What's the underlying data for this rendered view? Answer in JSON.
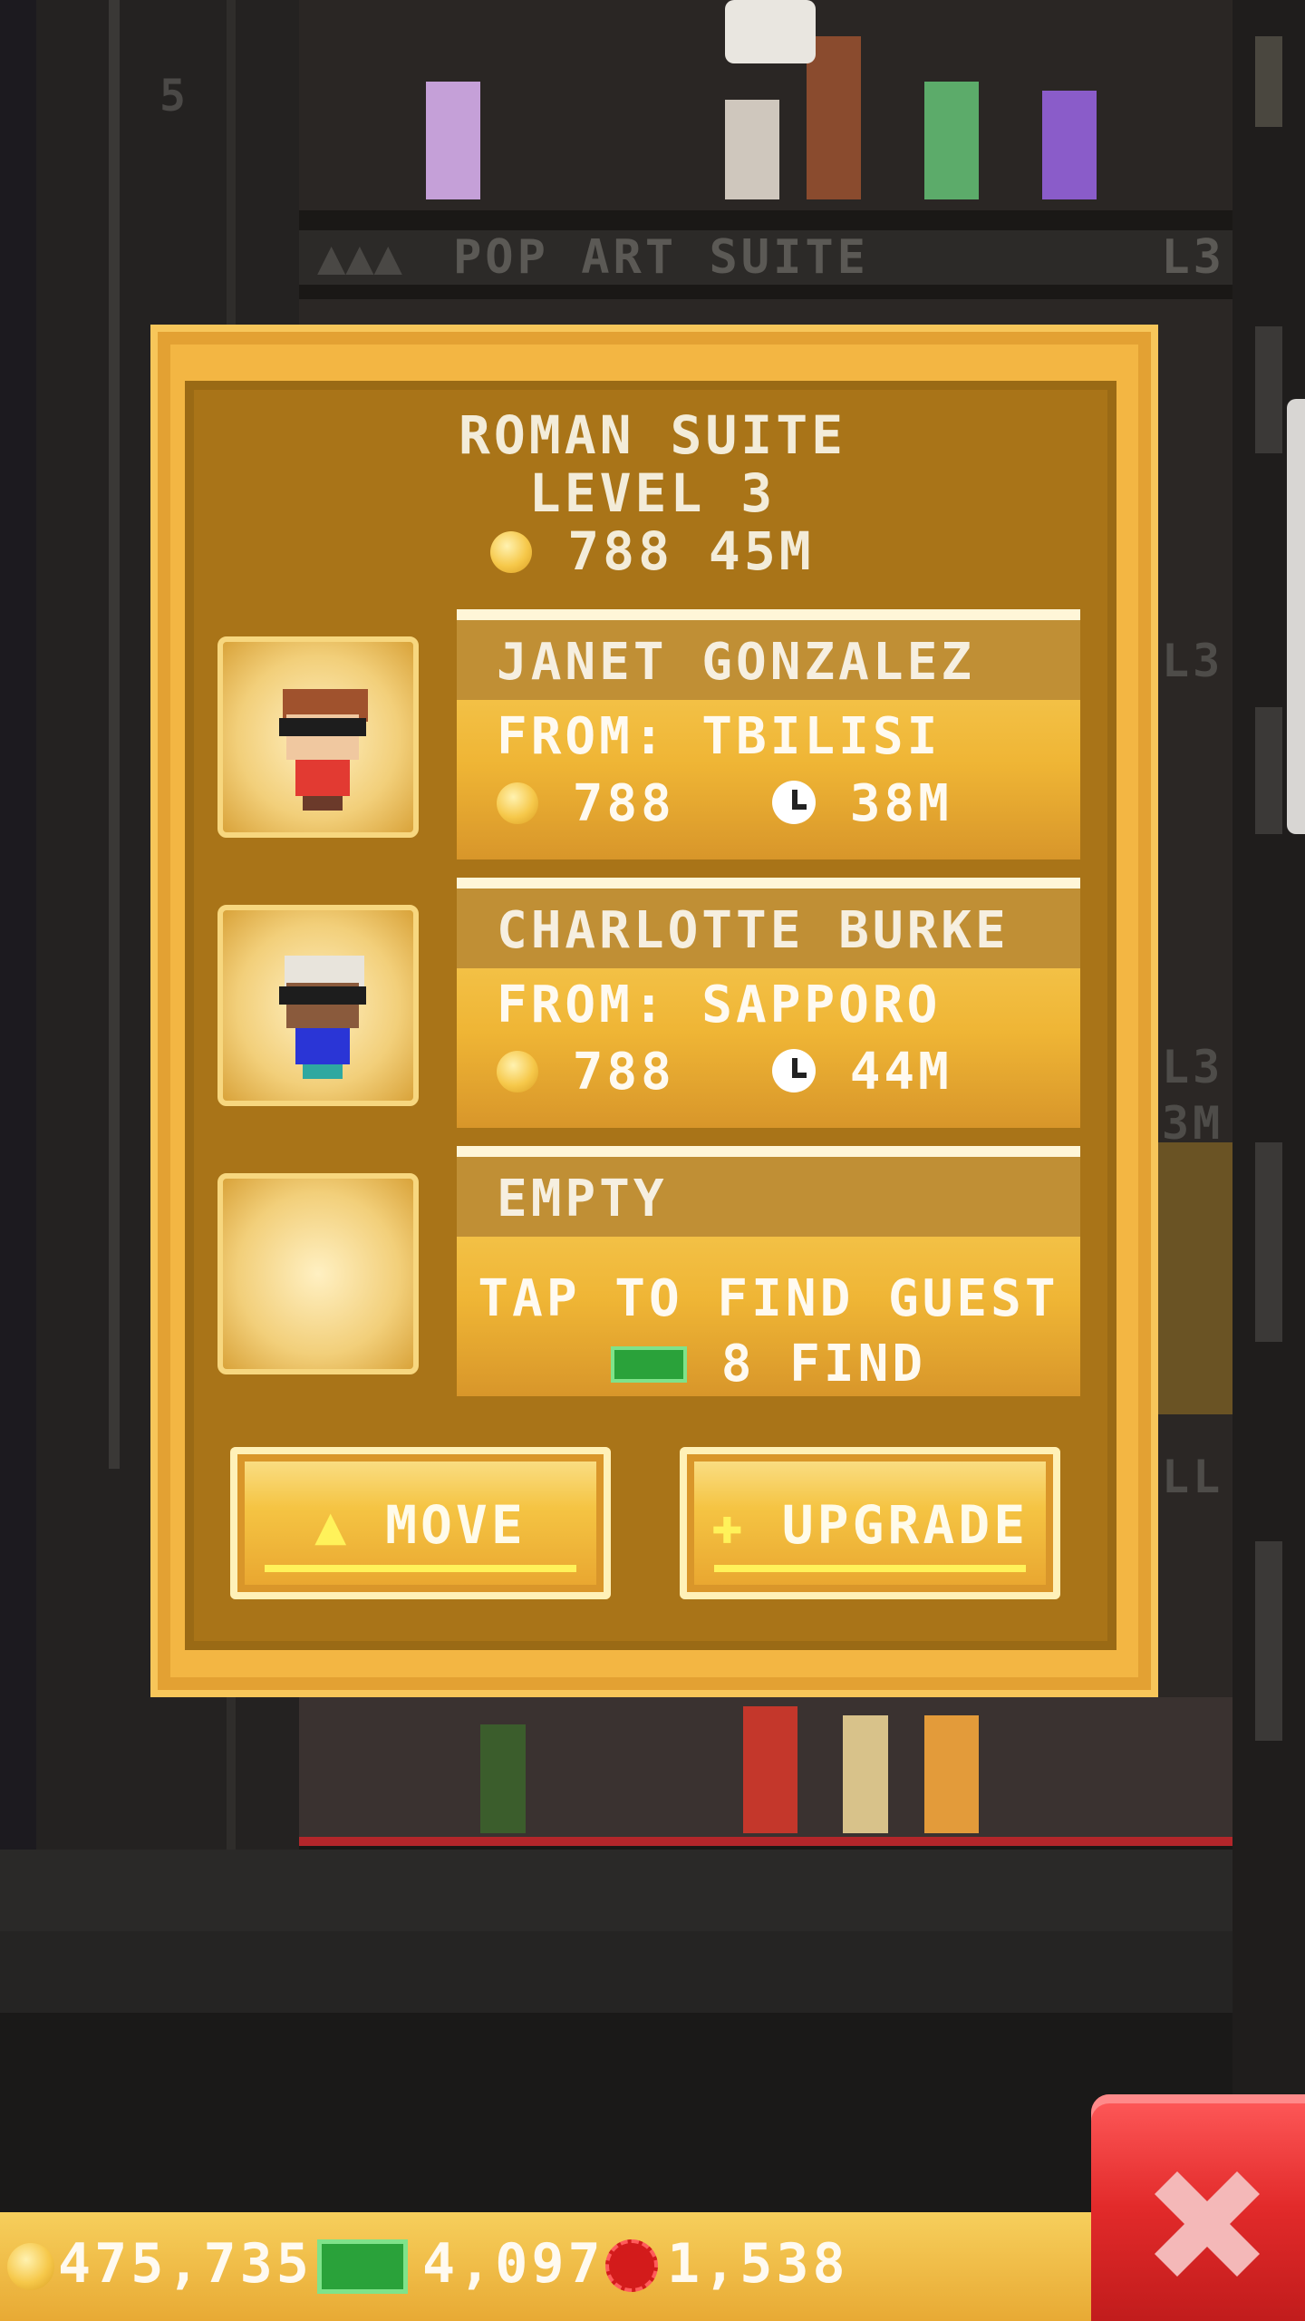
{
  "background": {
    "top_floor_number": "5",
    "top_floor_name": "POP ART SUITE",
    "top_floor_level": "L3",
    "side_level_labels": [
      "L3",
      "L3",
      "3M",
      "LL!"
    ]
  },
  "modal": {
    "title": "ROMAN SUITE",
    "level": "LEVEL 3",
    "summary_coins": "788",
    "summary_time": "45M",
    "guests": [
      {
        "name": "JANET GONZALEZ",
        "from": "FROM: TBILISI",
        "coins": "788",
        "time": "38M"
      },
      {
        "name": "CHARLOTTE BURKE",
        "from": "FROM: SAPPORO",
        "coins": "788",
        "time": "44M"
      }
    ],
    "empty_slot": {
      "title": "EMPTY",
      "action": "TAP TO FIND GUEST",
      "cost": "8",
      "cost_label": "FIND"
    },
    "buttons": {
      "move": "MOVE",
      "upgrade": "UPGRADE"
    }
  },
  "currency": {
    "coins": "475,735",
    "bux": "4,097",
    "tokens": "1,538"
  },
  "icons": [
    "coin-icon",
    "clock-icon",
    "bux-icon",
    "token-icon",
    "arrow-up-icon",
    "plus-icon",
    "close-icon"
  ],
  "colors": {
    "modal_gold": "#f3b643",
    "modal_inner": "#a97418",
    "close_red": "#e22a2a",
    "bux_green": "#2aa23a"
  }
}
